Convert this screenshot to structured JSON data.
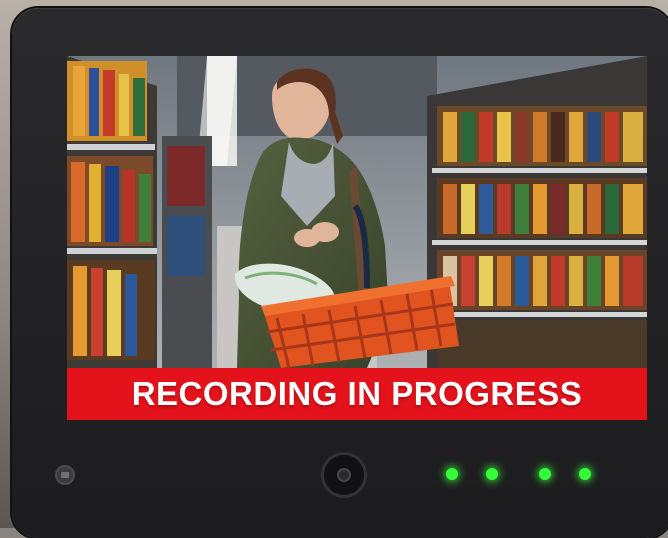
{
  "screen": {
    "banner_text": "RECORDING IN PROGRESS",
    "scene": "woman-shopping-in-grocery-aisle-image",
    "banner_color": "#e3121b"
  },
  "device": {
    "led_color": "#35ff3a",
    "led_count": 4,
    "bezel_color": "#1c1c1e"
  },
  "icons": [
    "menu-button-icon",
    "camera-lens-icon",
    "status-led-icon"
  ]
}
